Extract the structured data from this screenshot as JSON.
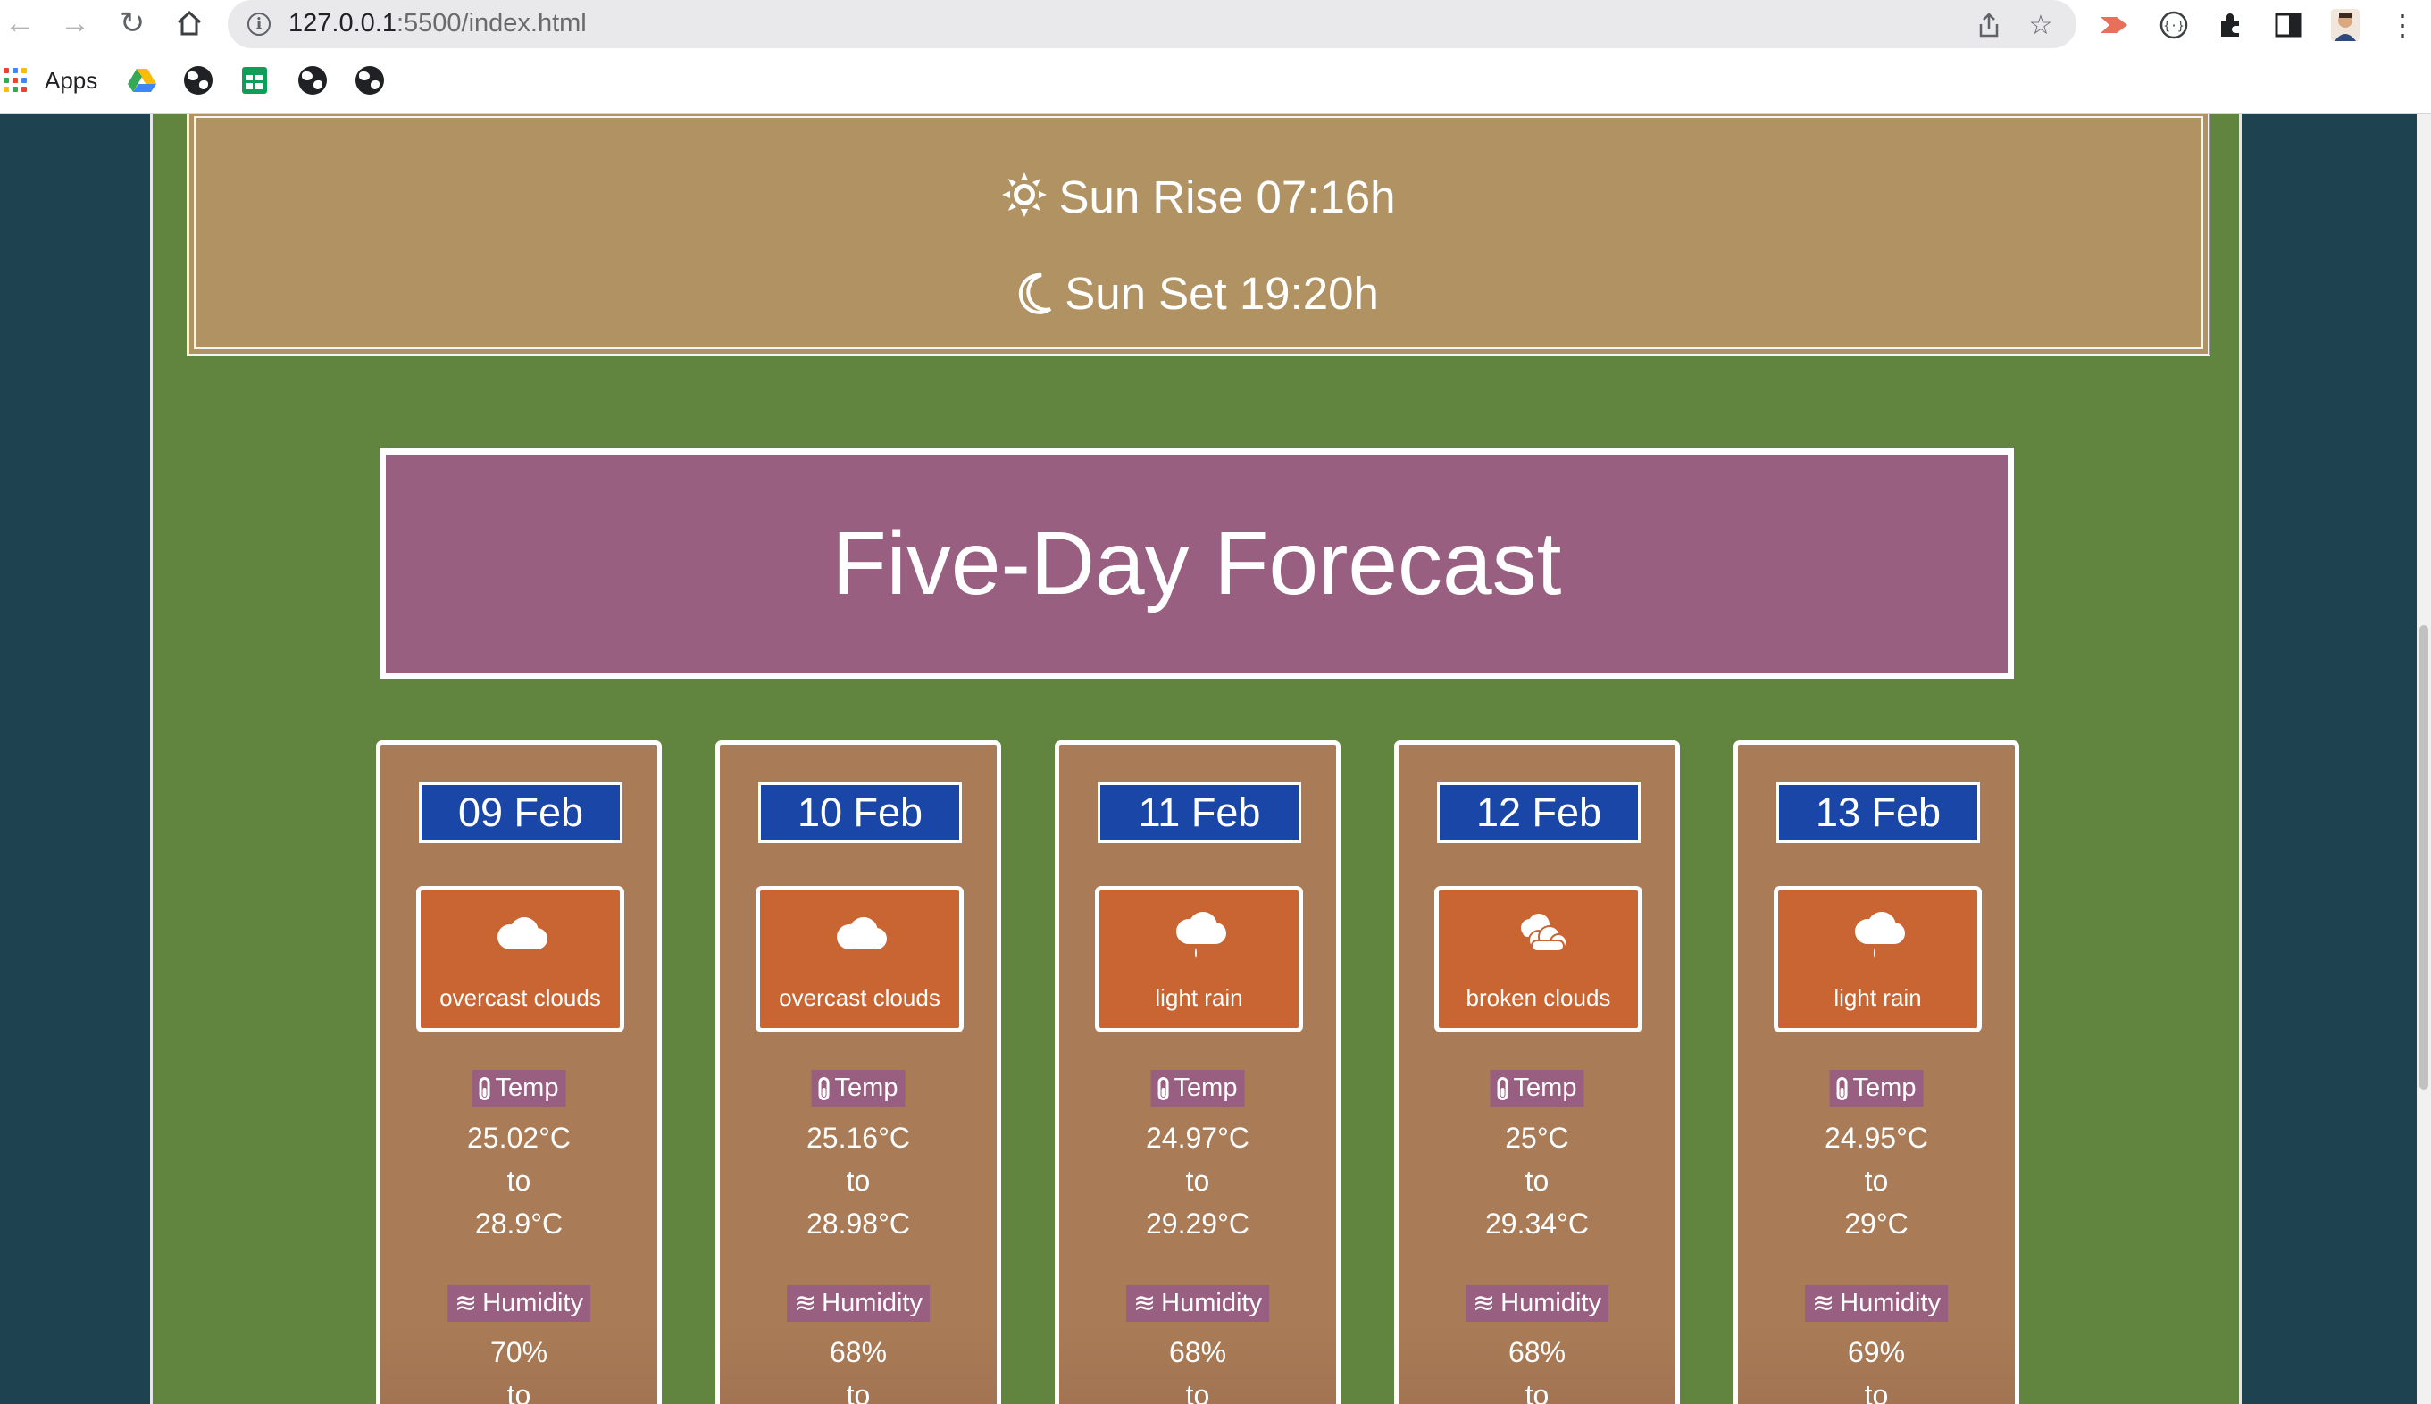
{
  "browser": {
    "url_host": "127.0.0.1",
    "url_rest": ":5500/index.html",
    "bookmarks": {
      "apps_label": "Apps"
    }
  },
  "sun": {
    "sunrise_text": "Sun Rise 07:16h",
    "sunset_text": "Sun Set 19:20h",
    "sunrise_icon": "sun-icon",
    "sunset_icon": "moon-icon"
  },
  "forecast": {
    "title": "Five-Day Forecast",
    "temp_label": "Temp",
    "humidity_label": "Humidity",
    "to_label": "to",
    "days": [
      {
        "date": "09 Feb",
        "description": "overcast clouds",
        "icon": "cloud-icon",
        "temp_min": "25.02°C",
        "temp_max": "28.9°C",
        "humidity_min": "70%"
      },
      {
        "date": "10 Feb",
        "description": "overcast clouds",
        "icon": "cloud-icon",
        "temp_min": "25.16°C",
        "temp_max": "28.98°C",
        "humidity_min": "68%"
      },
      {
        "date": "11 Feb",
        "description": "light rain",
        "icon": "rain-cloud-icon",
        "temp_min": "24.97°C",
        "temp_max": "29.29°C",
        "humidity_min": "68%"
      },
      {
        "date": "12 Feb",
        "description": "broken clouds",
        "icon": "broken-clouds-icon",
        "temp_min": "25°C",
        "temp_max": "29.34°C",
        "humidity_min": "68%"
      },
      {
        "date": "13 Feb",
        "description": "light rain",
        "icon": "rain-cloud-icon",
        "temp_min": "24.95°C",
        "temp_max": "29°C",
        "humidity_min": "69%"
      }
    ]
  },
  "colors": {
    "page_bg": "#1e4250",
    "container_bg": "#61843f",
    "sun_box_bg": "#b19263",
    "title_box_bg": "#995f80",
    "card_bg": "#a97b56",
    "date_badge_bg": "#1a46a8",
    "weather_box_bg": "#c86533",
    "label_chip_bg": "#995f80"
  }
}
